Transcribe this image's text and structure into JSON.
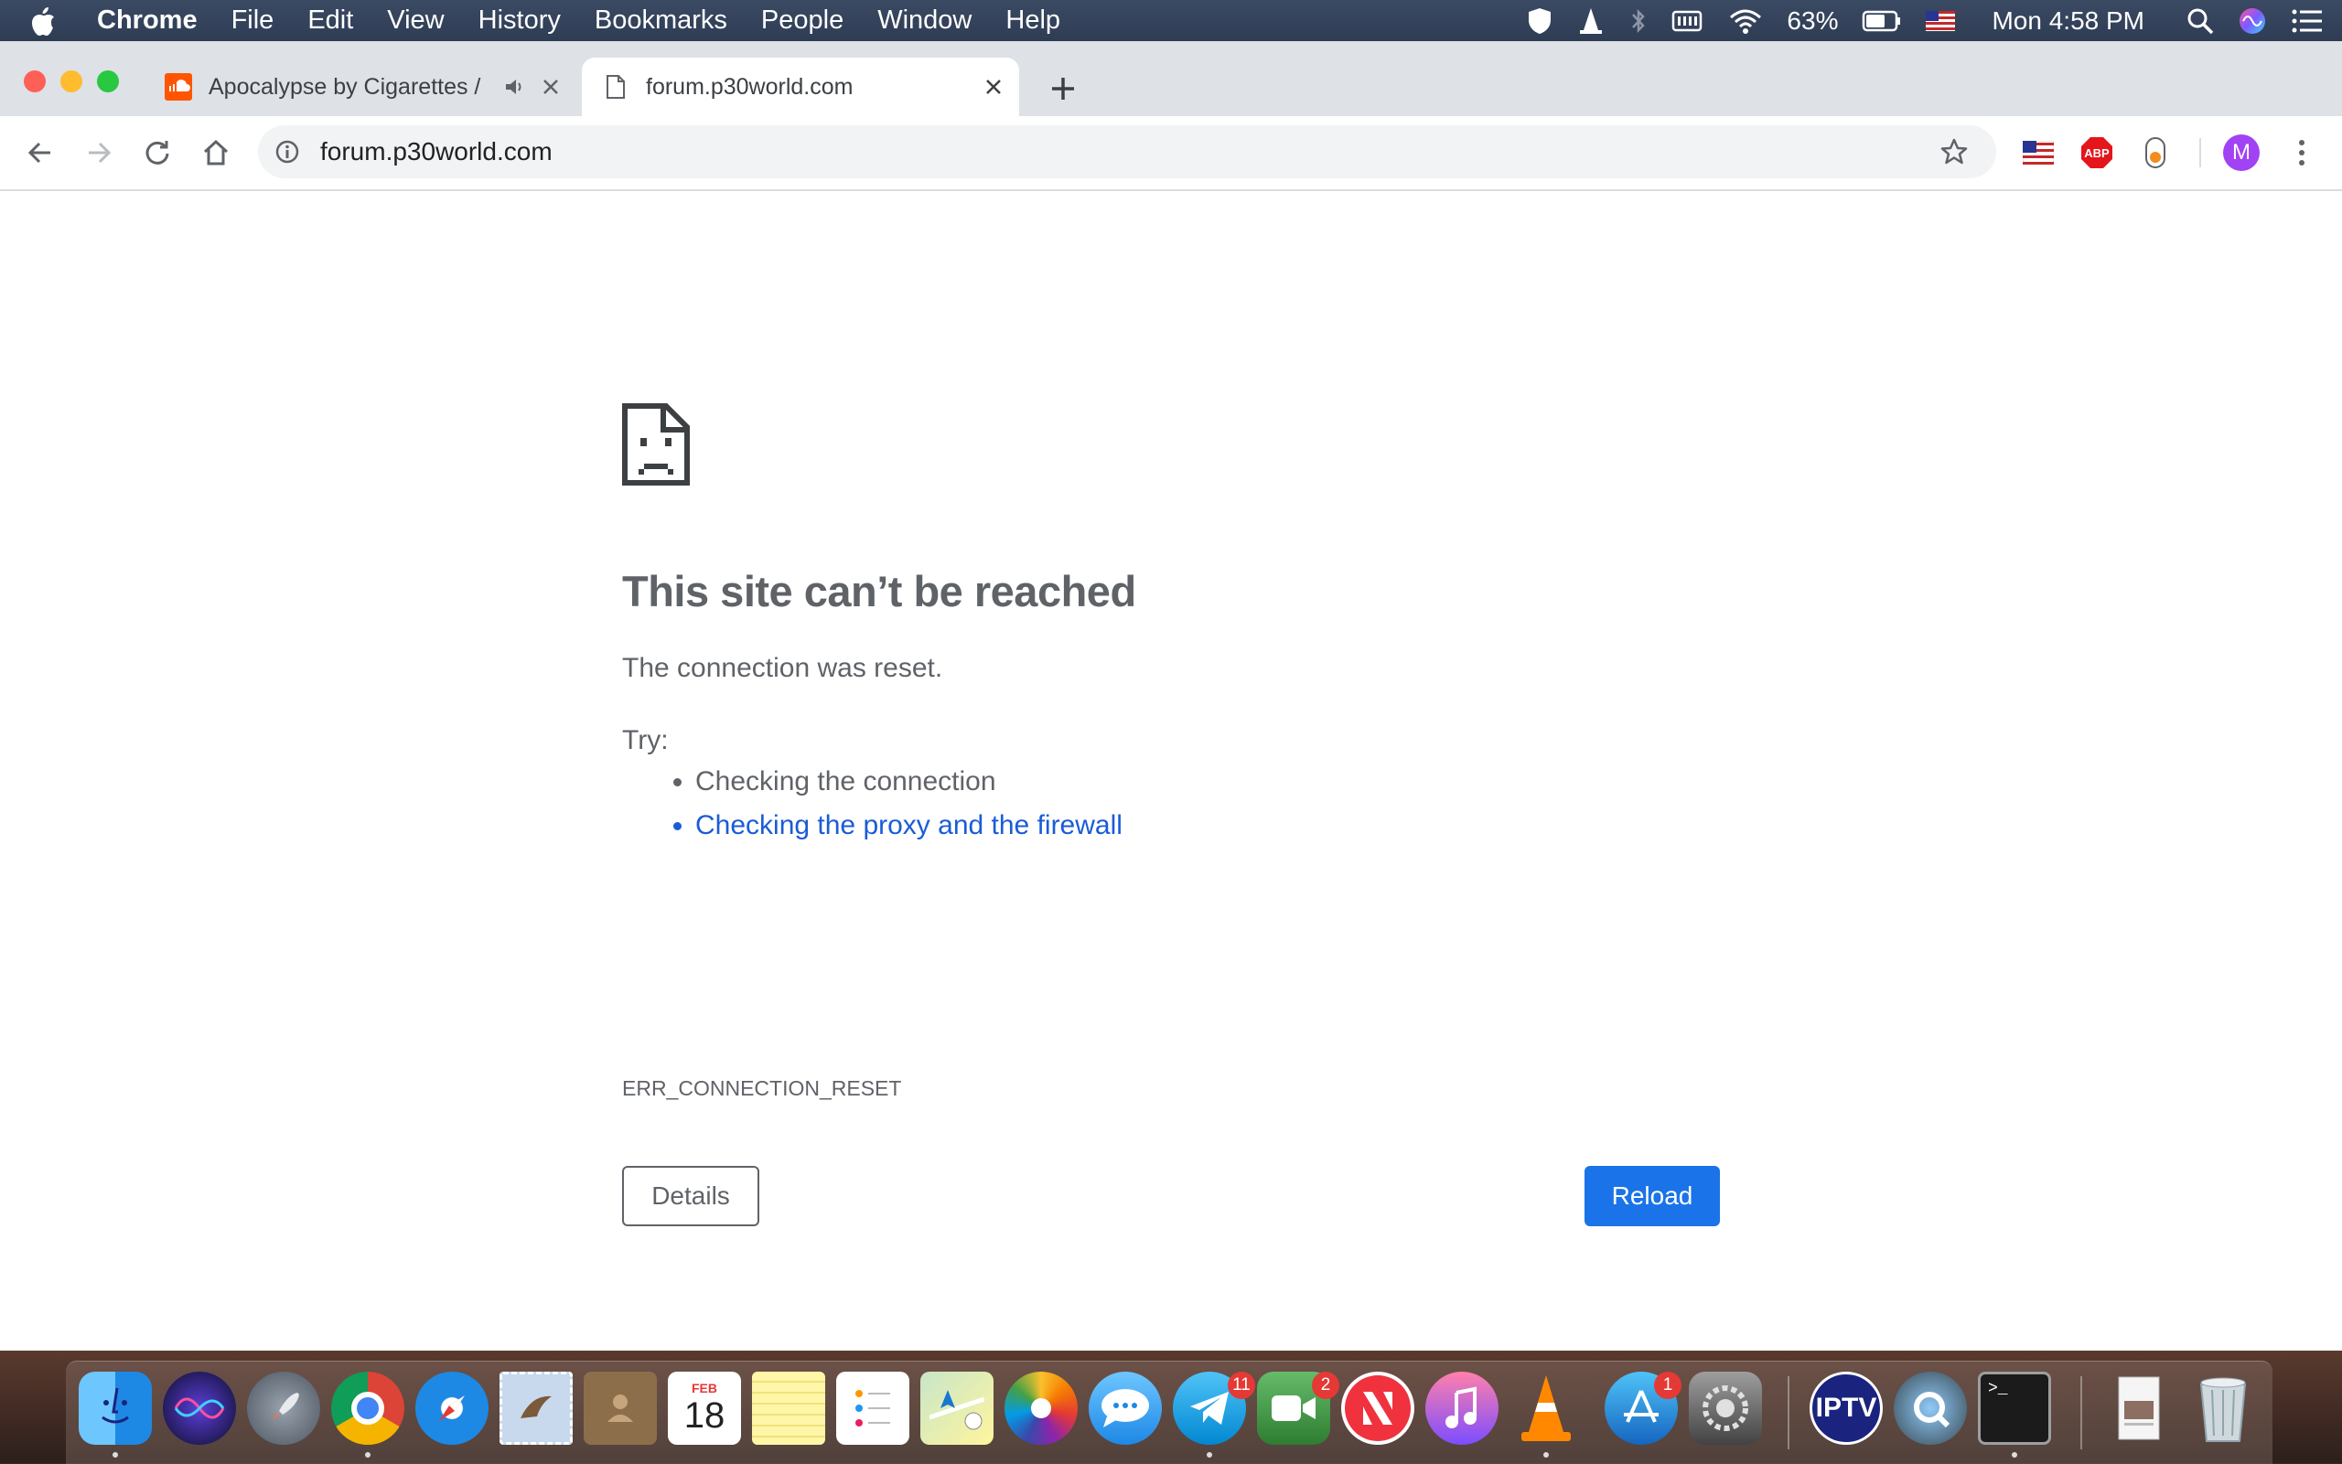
{
  "menubar": {
    "app_name": "Chrome",
    "items": [
      "File",
      "Edit",
      "View",
      "History",
      "Bookmarks",
      "People",
      "Window",
      "Help"
    ],
    "battery": "63%",
    "clock": "Mon 4:58 PM"
  },
  "tabs": [
    {
      "title": "Apocalypse by Cigarettes /",
      "active": false,
      "audio": true
    },
    {
      "title": "forum.p30world.com",
      "active": true,
      "audio": false
    }
  ],
  "omnibox": {
    "url": "forum.p30world.com"
  },
  "profile": {
    "initial": "M",
    "color": "#a142f4"
  },
  "extensions": {
    "abp_label": "ABP"
  },
  "error_page": {
    "heading": "This site can’t be reached",
    "description": "The connection was reset.",
    "try_label": "Try:",
    "suggestions": [
      "Checking the connection",
      "Checking the proxy and the firewall"
    ],
    "error_code": "ERR_CONNECTION_RESET",
    "details_label": "Details",
    "reload_label": "Reload"
  },
  "dock": {
    "calendar": {
      "month": "FEB",
      "day": "18"
    },
    "badges": {
      "telegram": "11",
      "facetime": "2",
      "app_store": "1"
    },
    "iptv_label": "IPTV",
    "terminal_prompt": ">_"
  },
  "colors": {
    "link": "#1a5cd7",
    "primary_button": "#1a73e8",
    "text_gray": "#5f6368",
    "tabstrip": "#dee1e6"
  }
}
